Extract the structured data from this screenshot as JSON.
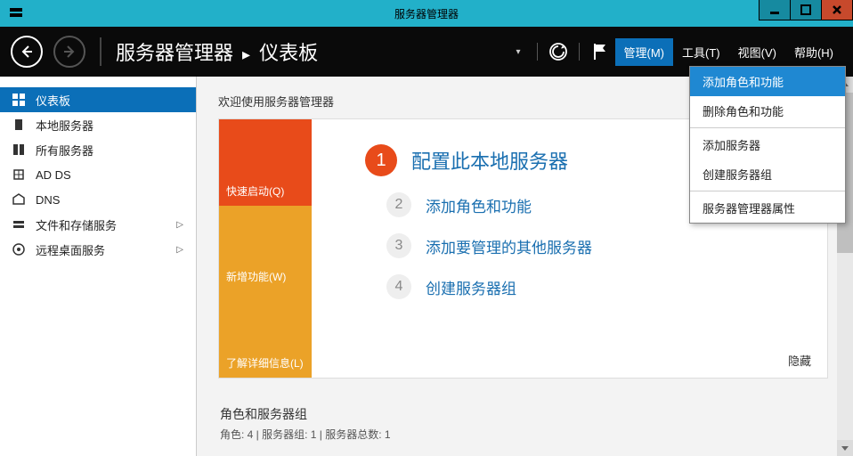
{
  "window": {
    "title": "服务器管理器"
  },
  "breadcrumb": {
    "app": "服务器管理器",
    "page": "仪表板"
  },
  "topMenu": {
    "manage": "管理(M)",
    "tools": "工具(T)",
    "view": "视图(V)",
    "help": "帮助(H)"
  },
  "manageMenu": {
    "addRoles": "添加角色和功能",
    "removeRoles": "删除角色和功能",
    "addServers": "添加服务器",
    "createGroup": "创建服务器组",
    "properties": "服务器管理器属性"
  },
  "sidebar": {
    "dashboard": "仪表板",
    "localServer": "本地服务器",
    "allServers": "所有服务器",
    "adds": "AD DS",
    "dns": "DNS",
    "fileStorage": "文件和存储服务",
    "remoteDesktop": "远程桌面服务"
  },
  "welcome": {
    "heading": "欢迎使用服务器管理器"
  },
  "strip": {
    "quickStart": "快速启动(Q)",
    "whatsNew": "新增功能(W)",
    "learnMore": "了解详细信息(L)"
  },
  "tasks": {
    "t1": "配置此本地服务器",
    "t2": "添加角色和功能",
    "t3": "添加要管理的其他服务器",
    "t4": "创建服务器组",
    "hide": "隐藏"
  },
  "roles": {
    "title": "角色和服务器组",
    "sub": "角色: 4 | 服务器组: 1 | 服务器总数: 1"
  }
}
